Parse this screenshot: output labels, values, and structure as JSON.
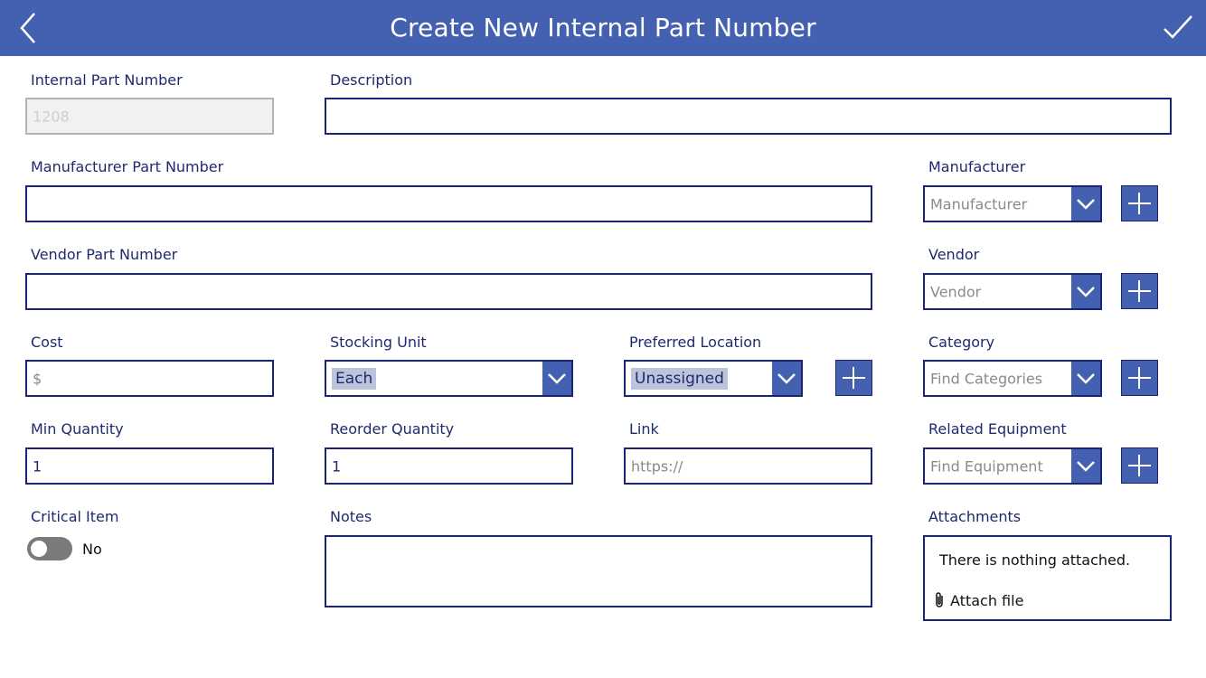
{
  "header": {
    "title": "Create New Internal Part Number",
    "back_icon": "chevron-left-icon",
    "save_icon": "checkmark-icon",
    "color": "#4361b0"
  },
  "form": {
    "internal_part_number": {
      "label": "Internal Part Number",
      "value": "1208"
    },
    "description": {
      "label": "Description",
      "value": ""
    },
    "manufacturer_part_number": {
      "label": "Manufacturer Part Number",
      "value": ""
    },
    "manufacturer": {
      "label": "Manufacturer",
      "placeholder": "Manufacturer"
    },
    "vendor_part_number": {
      "label": "Vendor Part Number",
      "value": ""
    },
    "vendor": {
      "label": "Vendor",
      "placeholder": "Vendor"
    },
    "cost": {
      "label": "Cost",
      "placeholder": "$"
    },
    "stocking_unit": {
      "label": "Stocking Unit",
      "value": "Each"
    },
    "preferred_location": {
      "label": "Preferred Location",
      "value": "Unassigned"
    },
    "category": {
      "label": "Category",
      "placeholder": "Find Categories"
    },
    "min_quantity": {
      "label": "Min Quantity",
      "value": "1"
    },
    "reorder_quantity": {
      "label": "Reorder Quantity",
      "value": "1"
    },
    "link": {
      "label": "Link",
      "placeholder": "https://"
    },
    "related_equipment": {
      "label": "Related Equipment",
      "placeholder": "Find Equipment"
    },
    "critical_item": {
      "label": "Critical Item",
      "value": "No",
      "checked": false
    },
    "notes": {
      "label": "Notes",
      "value": ""
    },
    "attachments": {
      "label": "Attachments",
      "empty_text": "There is nothing attached.",
      "attach_label": "Attach file"
    }
  },
  "colors": {
    "accent": "#4361b0",
    "border": "#1a2374",
    "text": "#1f2a6e"
  }
}
